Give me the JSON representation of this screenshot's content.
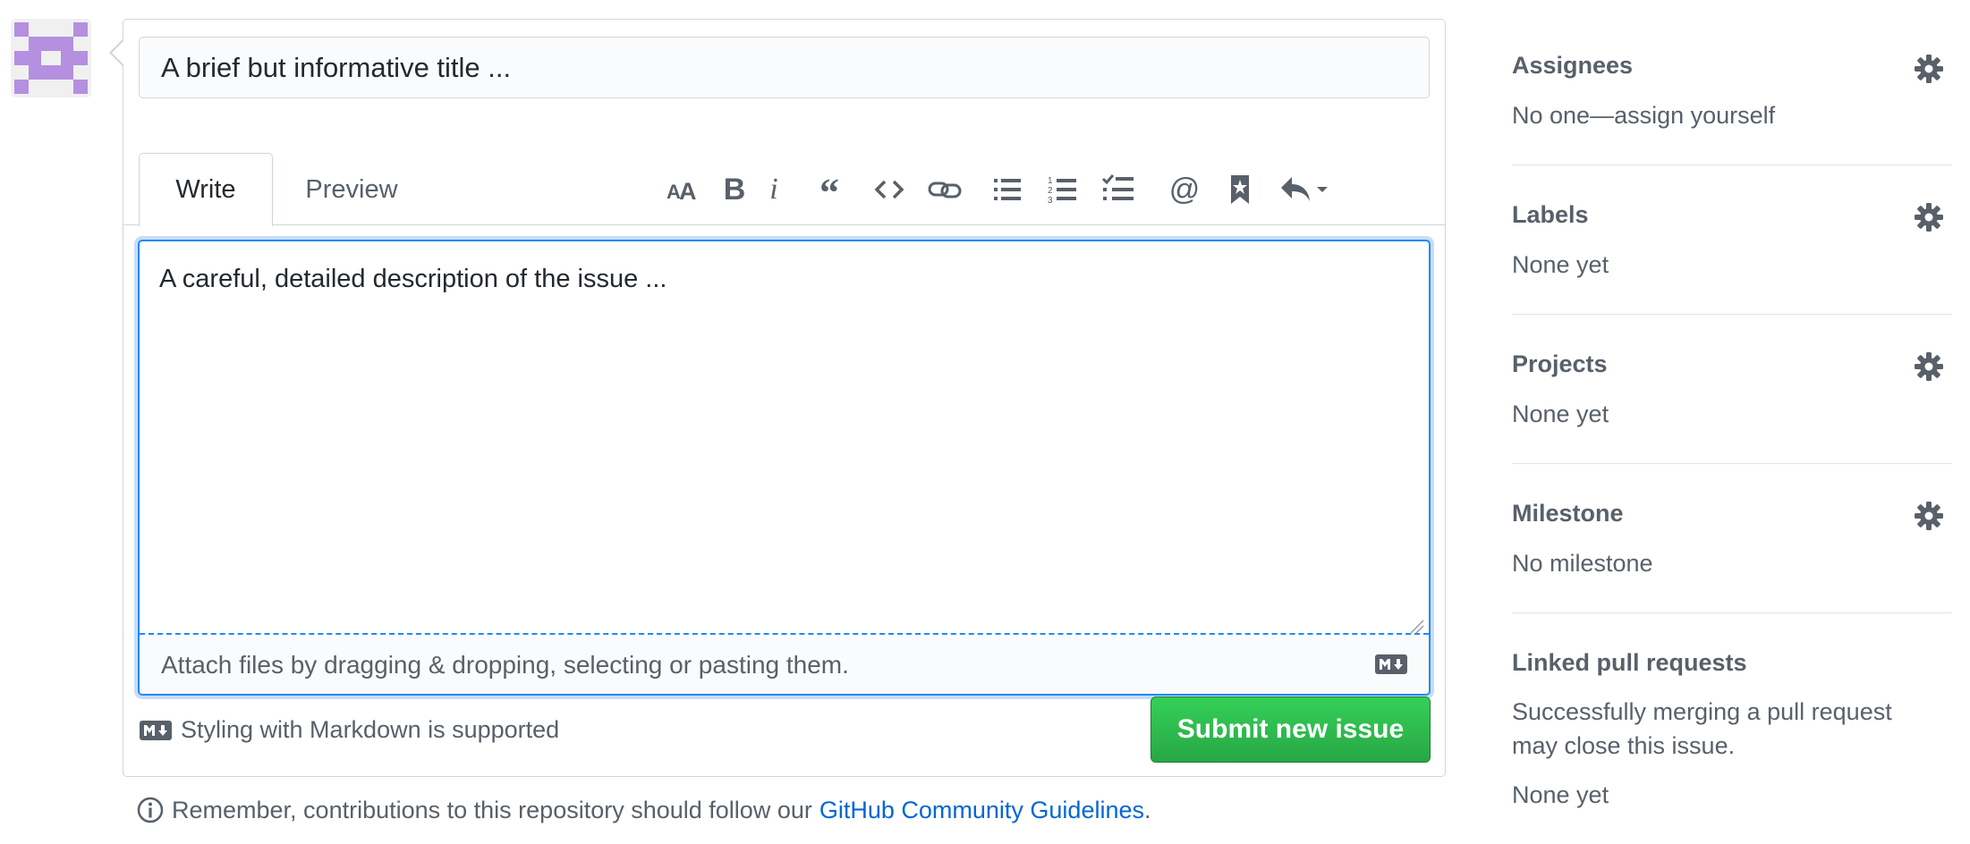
{
  "avatar": {
    "color": "#b58fe0"
  },
  "issue": {
    "title_value": "A brief but informative title ...",
    "tabs": [
      {
        "label": "Write"
      },
      {
        "label": "Preview"
      }
    ],
    "toolbar": [
      {
        "icon": "text-size-icon"
      },
      {
        "icon": "bold-icon",
        "glyph": "B"
      },
      {
        "icon": "italic-icon",
        "glyph": "i"
      },
      {
        "icon": "quote-icon"
      },
      {
        "icon": "code-icon"
      },
      {
        "icon": "link-icon"
      },
      {
        "icon": "unordered-list-icon"
      },
      {
        "icon": "ordered-list-icon"
      },
      {
        "icon": "task-list-icon"
      },
      {
        "icon": "mention-icon",
        "glyph": "@"
      },
      {
        "icon": "bookmark-icon"
      },
      {
        "icon": "reply-icon"
      }
    ],
    "body_value": "A careful, detailed description of the issue ...",
    "attach_text": "Attach files by dragging & dropping, selecting or pasting them.",
    "markdown_note": "Styling with Markdown is supported",
    "submit_label": "Submit new issue",
    "guidelines_prefix": "Remember, contributions to this repository should follow our",
    "guidelines_link": "GitHub Community Guidelines",
    "guidelines_suffix": "."
  },
  "sidebar": {
    "sections": [
      {
        "heading": "Assignees",
        "value": "No one—assign yourself"
      },
      {
        "heading": "Labels",
        "value": "None yet"
      },
      {
        "heading": "Projects",
        "value": "None yet"
      },
      {
        "heading": "Milestone",
        "value": "No milestone"
      },
      {
        "heading": "Linked pull requests",
        "value": "Successfully merging a pull request may close this issue.",
        "value2": "None yet"
      }
    ]
  },
  "colors": {
    "accent": "#0366d6",
    "submit": "#28a745",
    "focus": "#2188ff"
  }
}
